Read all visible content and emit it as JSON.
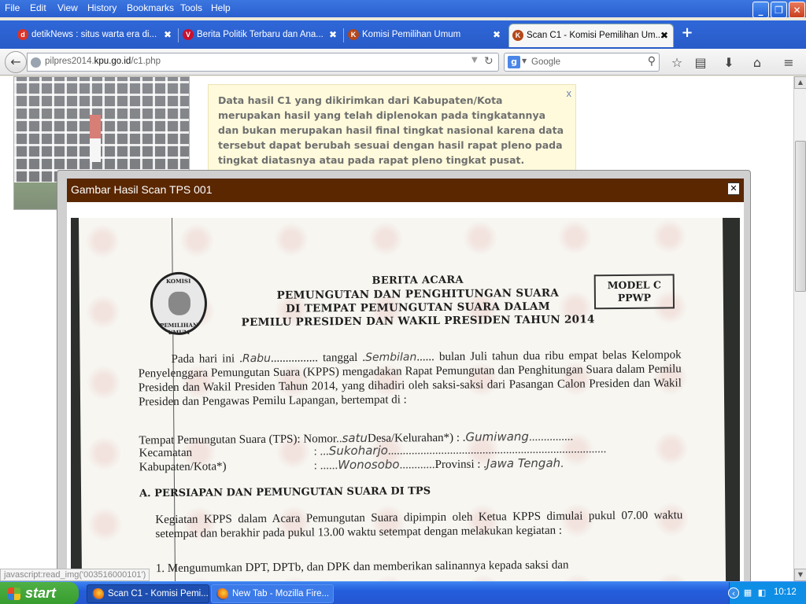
{
  "menubar": {
    "items": [
      "File",
      "Edit",
      "View",
      "History",
      "Bookmarks",
      "Tools",
      "Help"
    ]
  },
  "window_controls": {
    "minimize": "_",
    "restore": "❐",
    "close": "✕"
  },
  "tabs": [
    {
      "title": "detikNews : situs warta era di...",
      "favicon_letter": "d",
      "favicon_color": "#d9332a",
      "active": false
    },
    {
      "title": "Berita Politik Terbaru dan Ana...",
      "favicon_letter": "V",
      "favicon_color": "#c8102e",
      "active": false
    },
    {
      "title": "Komisi Pemilihan Umum",
      "favicon_letter": "K",
      "favicon_color": "#b5471a",
      "active": false
    },
    {
      "title": "Scan C1 - Komisi Pemilihan Um...",
      "favicon_letter": "K",
      "favicon_color": "#b5471a",
      "active": true
    }
  ],
  "tab_close_glyph": "✖",
  "new_tab_glyph": "+",
  "navbar": {
    "back_glyph": "←",
    "url_prefix": "pilpres2014.",
    "url_domain": "kpu.go.id",
    "url_suffix": "/c1.php",
    "search_placeholder": "Google",
    "search_engine_letter": "g"
  },
  "toolbar_icons": [
    "star-icon",
    "reading-list-icon",
    "download-icon",
    "home-icon",
    "menu-icon"
  ],
  "toolbar_glyphs": {
    "star": "☆",
    "reading": "▤",
    "download": "⬇",
    "home": "⌂",
    "menu": "≡"
  },
  "notice": {
    "text": "Data hasil C1 yang dikirimkan dari Kabupaten/Kota merupakan hasil yang telah diplenokan pada tingkatannya dan bukan merupakan hasil final tingkat nasional karena data tersebut dapat berubah sesuai dengan hasil rapat pleno pada tingkat diatasnya atau pada rapat pleno tingkat pusat.",
    "close": "x"
  },
  "modal": {
    "title": "Gambar Hasil Scan TPS 001",
    "close": "✕"
  },
  "document": {
    "seal_top": "KOMISI",
    "seal_bottom": "PEMILIHAN UMUM",
    "title_lines": [
      "BERITA ACARA",
      "PEMUNGUTAN DAN PENGHITUNGAN SUARA",
      "DI TEMPAT PEMUNGUTAN SUARA DALAM",
      "PEMILU PRESIDEN DAN WAKIL PRESIDEN TAHUN 2014"
    ],
    "model_line1": "MODEL C",
    "model_line2": "PPWP",
    "intro_part1": "Pada hari ini .",
    "hw_day": "Rabu",
    "intro_part2": "................ tanggal .",
    "hw_date": "Sembilan",
    "intro_part3": "...... bulan Juli tahun dua ribu empat belas Kelompok Penyelenggara Pemungutan Suara (KPPS) mengadakan Rapat Pemungutan dan Penghitungan Suara dalam Pemilu Presiden dan Wakil Presiden Tahun 2014, yang dihadiri oleh saksi-saksi dari Pasangan Calon Presiden dan Wakil Presiden dan Pengawas Pemilu Lapangan, bertempat di :",
    "tps_label": "Tempat Pemungutan Suara (TPS): Nomor",
    "hw_tps": "satu",
    "desa_label": "Desa/Kelurahan*) : .",
    "hw_desa": "Gumiwang",
    "kecamatan_label": "Kecamatan",
    "hw_kecamatan": "Sukoharjo",
    "kabupaten_label": "Kabupaten/Kota*)",
    "hw_kabupaten": "Wonosobo",
    "provinsi_label": "Provinsi : .",
    "hw_provinsi": "Jawa Tengah",
    "section_a": "A. PERSIAPAN DAN PEMUNGUTAN SUARA DI TPS",
    "para_a": "Kegiatan KPPS dalam Acara Pemungutan Suara dipimpin oleh Ketua KPPS dimulai pukul 07.00 waktu setempat dan berakhir pada pukul 13.00 waktu setempat dengan melakukan kegiatan :",
    "item1": "1.  Mengumumkan DPT, DPTb, dan DPK dan memberikan salinannya kepada saksi dan"
  },
  "statusbar": {
    "link": "javascript:read_img('003516000101')"
  },
  "taskbar": {
    "start": "start",
    "buttons": [
      {
        "label": "Scan C1 - Komisi Pemi...",
        "pressed": true
      },
      {
        "label": "New Tab - Mozilla Fire...",
        "pressed": false
      }
    ],
    "clock": "10:12"
  },
  "colors": {
    "modal_header": "#5a2700",
    "notice_bg": "#fdf8c8",
    "taskbar_blue": "#245edc",
    "start_green": "#379c2e"
  }
}
